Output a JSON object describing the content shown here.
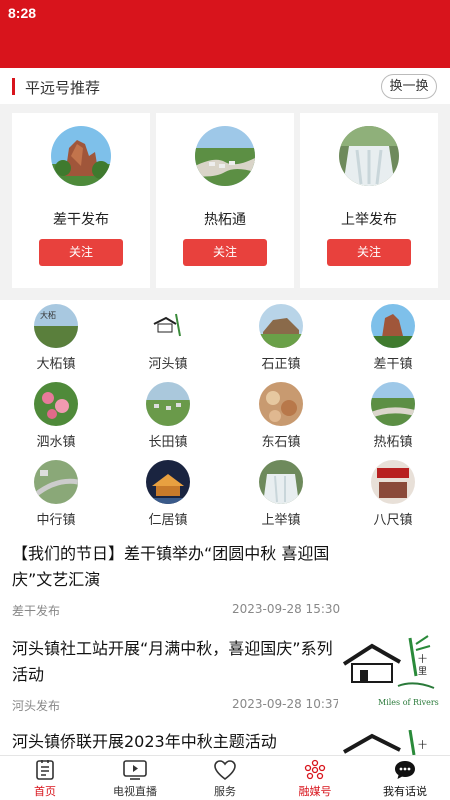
{
  "status_bar": {
    "time": "8:28"
  },
  "recommend": {
    "title": "平远号推荐",
    "refresh_label": "换一换",
    "cards": [
      {
        "name": "差干发布",
        "follow_label": "关注"
      },
      {
        "name": "热柘通",
        "follow_label": "关注"
      },
      {
        "name": "上举发布",
        "follow_label": "关注"
      }
    ]
  },
  "towns": [
    {
      "name": "大柘镇"
    },
    {
      "name": "河头镇"
    },
    {
      "name": "石正镇"
    },
    {
      "name": "差干镇"
    },
    {
      "name": "泗水镇"
    },
    {
      "name": "长田镇"
    },
    {
      "name": "东石镇"
    },
    {
      "name": "热柘镇"
    },
    {
      "name": "中行镇"
    },
    {
      "name": "仁居镇"
    },
    {
      "name": "上举镇"
    },
    {
      "name": "八尺镇"
    }
  ],
  "news": [
    {
      "title_line1": "【我们的节日】差干镇举办“团圆中秋 喜迎国",
      "title_line2": "庆”文艺汇演",
      "source": "差干发布",
      "time": "2023-09-28 15:30"
    },
    {
      "title_line1": "河头镇社工站开展“月满中秋，喜迎国庆”系列",
      "title_line2": "活动",
      "source": "河头发布",
      "time": "2023-09-28 10:37",
      "thumb_caption": "Miles of Rivers"
    },
    {
      "title_line1": "河头镇侨联开展2023年中秋主题活动"
    }
  ],
  "tabs": [
    {
      "label": "首页",
      "icon": "home-doc-icon"
    },
    {
      "label": "电视直播",
      "icon": "tv-play-icon"
    },
    {
      "label": "服务",
      "icon": "heart-icon"
    },
    {
      "label": "融媒号",
      "icon": "dots-cluster-icon",
      "active": true
    },
    {
      "label": "我有话说",
      "icon": "speech-bubble-icon"
    }
  ],
  "colors": {
    "brand_red": "#d8141c",
    "follow_button": "#e8413d",
    "text_gray": "#888888"
  }
}
